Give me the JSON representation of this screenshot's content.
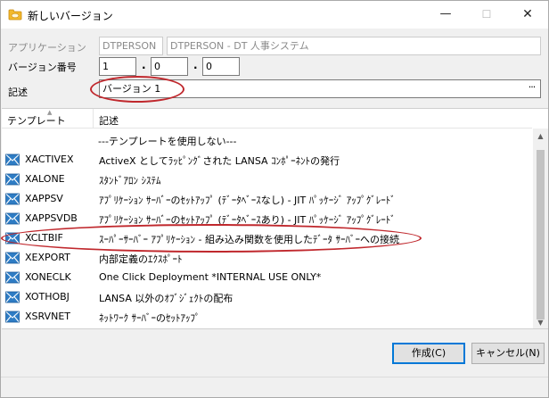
{
  "window": {
    "title": "新しいバージョン",
    "minimize_glyph": "—",
    "maximize_glyph": "☐",
    "close_glyph": "✕"
  },
  "form": {
    "application_label": "アプリケーション",
    "application_code": "DTPERSON",
    "application_name": "DTPERSON - DT 人事システム",
    "version_label": "バージョン番号",
    "version_major": "1",
    "version_minor": "0",
    "version_patch": "0",
    "version_dot": ".",
    "description_label": "記述",
    "description_value": "バージョン 1",
    "browse_glyph": "···"
  },
  "list": {
    "col_template": "テンプレート",
    "col_description": "記述",
    "placeholder_row": "---テンプレートを使用しない---",
    "rows": [
      {
        "name": "XACTIVEX",
        "desc": "ActiveX としてﾗｯﾋﾟﾝｸﾞされた LANSA ｺﾝﾎﾟｰﾈﾝﾄの発行"
      },
      {
        "name": "XALONE",
        "desc": "ｽﾀﾝﾄﾞｱﾛﾝ ｼｽﾃﾑ"
      },
      {
        "name": "XAPPSV",
        "desc": "ｱﾌﾟﾘｹｰｼｮﾝ ｻｰﾊﾞｰのｾｯﾄｱｯﾌﾟ (ﾃﾞｰﾀﾍﾞｰｽなし) - JIT ﾊﾟｯｹｰｼﾞ ｱｯﾌﾟｸﾞﾚｰﾄﾞ"
      },
      {
        "name": "XAPPSVDB",
        "desc": "ｱﾌﾟﾘｹｰｼｮﾝ ｻｰﾊﾞｰのｾｯﾄｱｯﾌﾟ (ﾃﾞｰﾀﾍﾞｰｽあり) - JIT ﾊﾟｯｹｰｼﾞ ｱｯﾌﾟｸﾞﾚｰﾄﾞ"
      },
      {
        "name": "XCLTBIF",
        "desc": "ｽｰﾊﾟｰｻｰﾊﾞｰ ｱﾌﾟﾘｹｰｼｮﾝ - 組み込み関数を使用したﾃﾞｰﾀ ｻｰﾊﾞｰへの接続"
      },
      {
        "name": "XEXPORT",
        "desc": "内部定義のｴｸｽﾎﾟｰﾄ"
      },
      {
        "name": "XONECLK",
        "desc": "One Click Deployment *INTERNAL USE ONLY*"
      },
      {
        "name": "XOTHOBJ",
        "desc": "LANSA 以外のｵﾌﾞｼﾞｪｸﾄの配布"
      },
      {
        "name": "XSRVNET",
        "desc": "ﾈｯﾄﾜｰｸ ｻｰﾊﾞｰのｾｯﾄｱｯﾌﾟ"
      }
    ]
  },
  "buttons": {
    "create": "作成(C)",
    "cancel": "キャンセル(N)"
  },
  "colors": {
    "highlight_oval": "#c0282d",
    "icon_blue": "#2e7cc4"
  }
}
